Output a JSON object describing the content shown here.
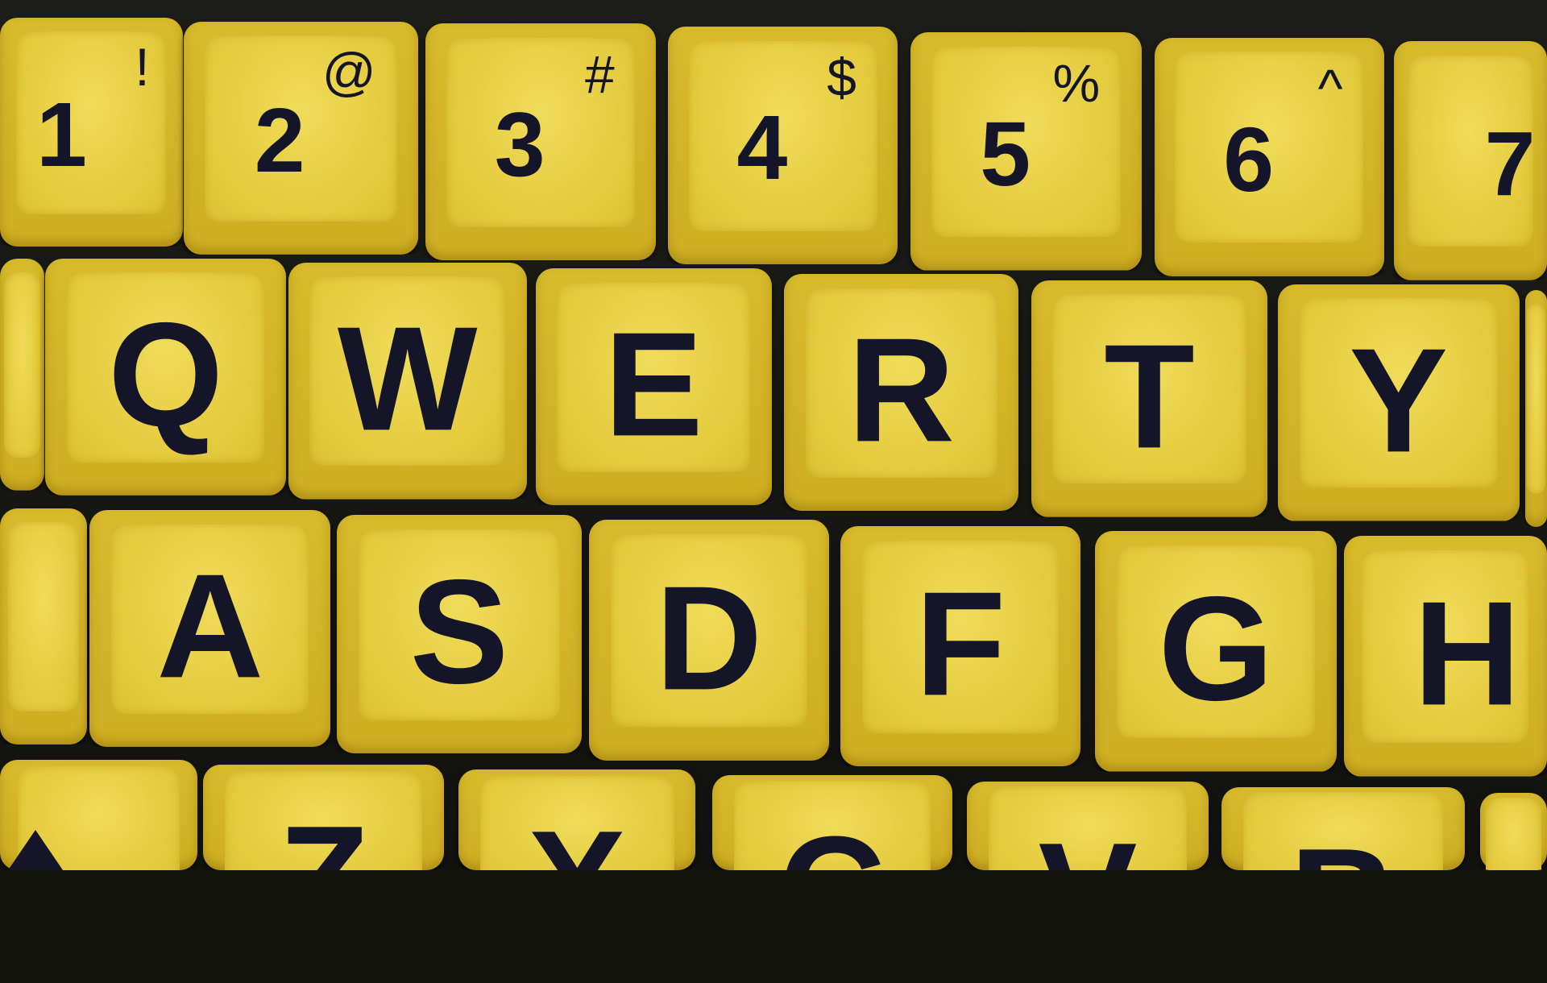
{
  "keyboard": {
    "key_color": "#e6cc40",
    "legend_color": "#15152a",
    "number_row": [
      {
        "main": "1",
        "shift": "!"
      },
      {
        "main": "2",
        "shift": "@"
      },
      {
        "main": "3",
        "shift": "#"
      },
      {
        "main": "4",
        "shift": "$"
      },
      {
        "main": "5",
        "shift": "%"
      },
      {
        "main": "6",
        "shift": "^"
      },
      {
        "main": "7",
        "shift": ""
      }
    ],
    "top_row": [
      "Q",
      "W",
      "E",
      "R",
      "T",
      "Y"
    ],
    "home_row": [
      "A",
      "S",
      "D",
      "F",
      "G",
      "H"
    ],
    "bottom_row": [
      "Z",
      "X",
      "C",
      "V",
      "B"
    ]
  }
}
